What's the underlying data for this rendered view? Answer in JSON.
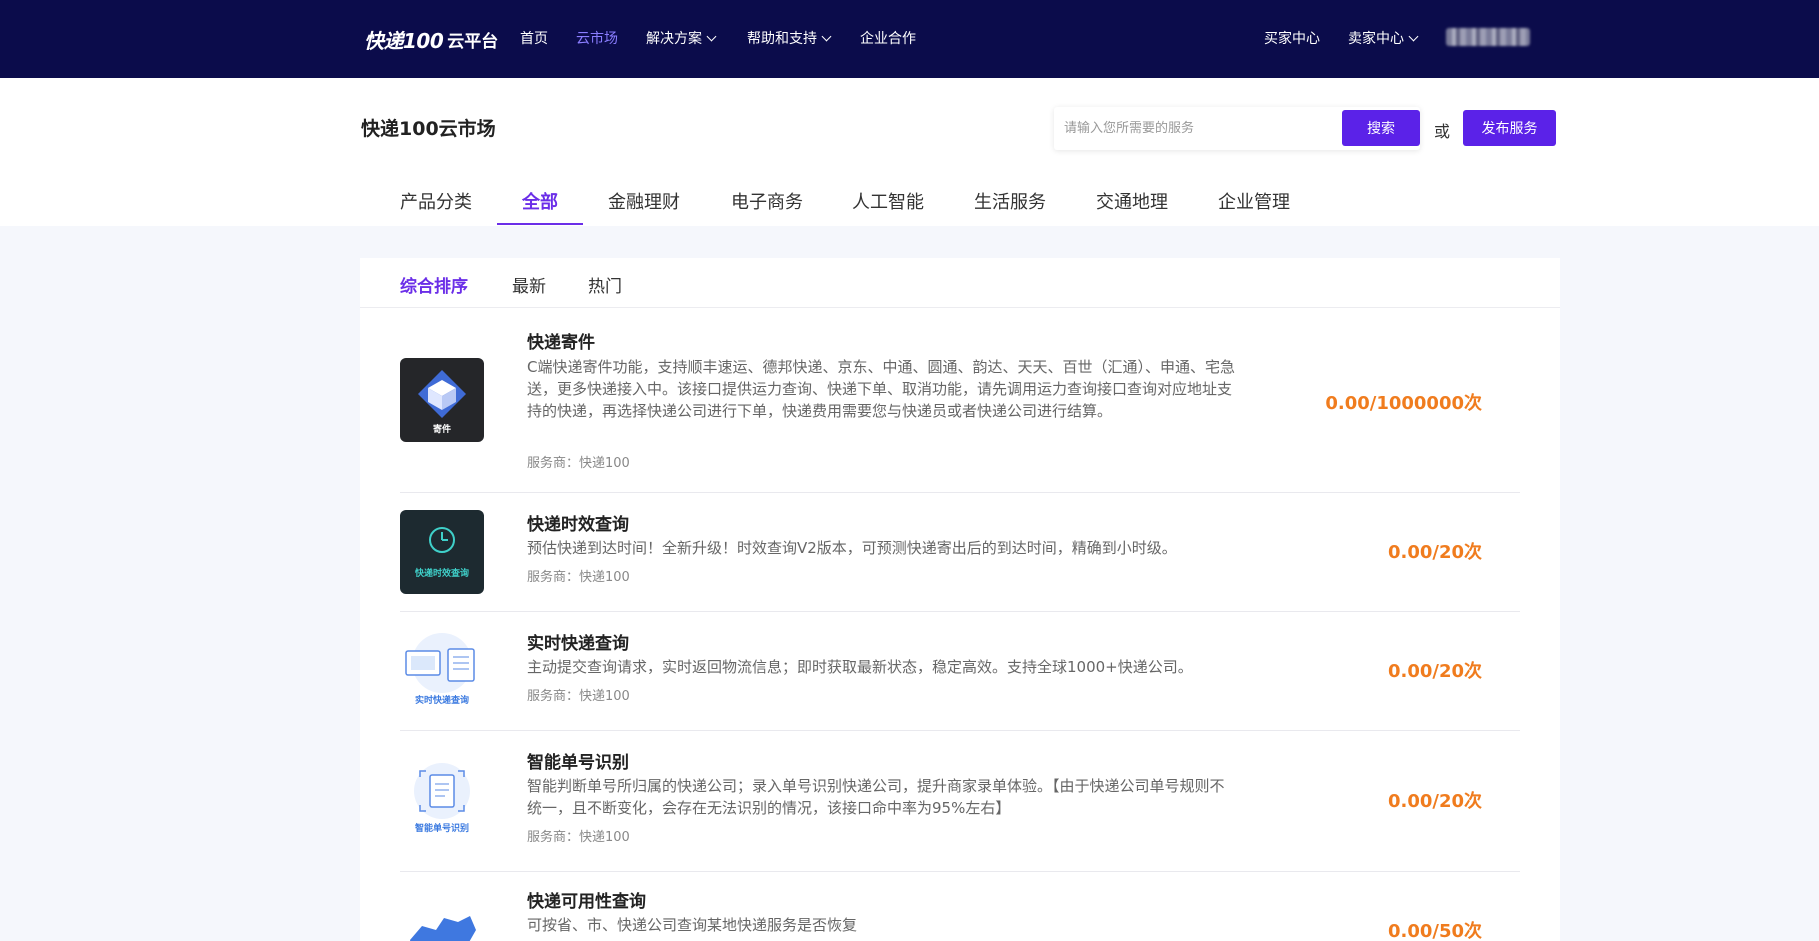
{
  "topnav": {
    "brand": "快递100",
    "platform": "云平台",
    "items": [
      {
        "label": "首页",
        "active": false
      },
      {
        "label": "云市场",
        "active": true
      },
      {
        "label": "解决方案",
        "dropdown": true
      },
      {
        "label": "帮助和支持",
        "dropdown": true
      },
      {
        "label": "企业合作"
      }
    ],
    "right": [
      {
        "label": "买家中心"
      },
      {
        "label": "卖家中心",
        "dropdown": true
      }
    ]
  },
  "header": {
    "title": "快递100云市场",
    "search_placeholder": "请输入您所需要的服务",
    "search_button": "搜索",
    "or": "或",
    "publish_button": "发布服务"
  },
  "categories": [
    {
      "label": "产品分类"
    },
    {
      "label": "全部",
      "active": true
    },
    {
      "label": "金融理财"
    },
    {
      "label": "电子商务"
    },
    {
      "label": "人工智能"
    },
    {
      "label": "生活服务"
    },
    {
      "label": "交通地理"
    },
    {
      "label": "企业管理"
    }
  ],
  "sort_tabs": [
    {
      "label": "综合排序",
      "active": true
    },
    {
      "label": "最新"
    },
    {
      "label": "热门"
    }
  ],
  "products": [
    {
      "title": "快递寄件",
      "desc": "C端快递寄件功能，支持顺丰速运、德邦快递、京东、中通、圆通、韵达、天天、百世（汇通）、申通、宅急送，更多快递接入中。该接口提供运力查询、快递下单、取消功能，请先调用运力查询接口查询对应地址支持的快递，再选择快递公司进行下单，快递费用需要您与快递员或者快递公司进行结算。",
      "provider": "服务商：快递100",
      "price": "0.00/1000000次",
      "thumb_label": "寄件",
      "thumb_icon": "parcel-icon"
    },
    {
      "title": "快递时效查询",
      "desc": "预估快递到达时间！全新升级！时效查询V2版本，可预测快递寄出后的到达时间，精确到小时级。",
      "provider": "服务商：快递100",
      "price": "0.00/20次",
      "thumb_label": "快递时效查询",
      "thumb_icon": "clock-icon"
    },
    {
      "title": "实时快递查询",
      "desc": "主动提交查询请求，实时返回物流信息；即时获取最新状态，稳定高效。支持全球1000+快递公司。",
      "provider": "服务商：快递100",
      "price": "0.00/20次",
      "thumb_label": "实时快递查询",
      "thumb_icon": "monitor-icon"
    },
    {
      "title": "智能单号识别",
      "desc": "智能判断单号所归属的快递公司；录入单号识别快递公司，提升商家录单体验。【由于快递公司单号规则不统一，且不断变化，会存在无法识别的情况，该接口命中率为95%左右】",
      "provider": "服务商：快递100",
      "price": "0.00/20次",
      "thumb_label": "智能单号识别",
      "thumb_icon": "scan-document-icon"
    },
    {
      "title": "快递可用性查询",
      "desc": "可按省、市、快递公司查询某地快递服务是否恢复",
      "provider": "",
      "price": "0.00/50次",
      "thumb_label": "",
      "thumb_icon": "china-map-icon"
    }
  ],
  "colors": {
    "nav_bg": "#0b0c4b",
    "accent": "#6b2ee8",
    "button": "#5b22e8",
    "price": "#f07c1e"
  }
}
